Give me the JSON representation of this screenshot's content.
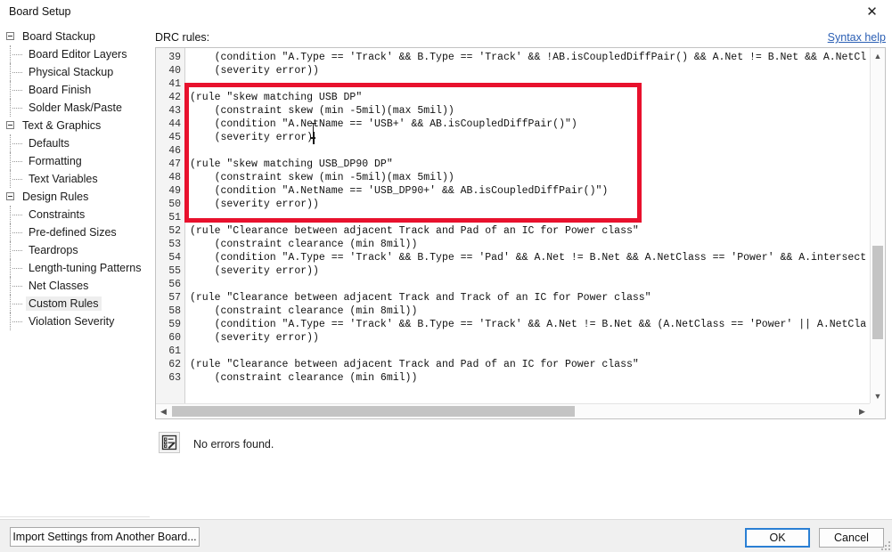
{
  "window": {
    "title": "Board Setup",
    "close_icon": "close-icon"
  },
  "sidebar": {
    "items": [
      {
        "label": "Board Stackup",
        "type": "group",
        "selected": false
      },
      {
        "label": "Board Editor Layers",
        "type": "child",
        "selected": false
      },
      {
        "label": "Physical Stackup",
        "type": "child",
        "selected": false
      },
      {
        "label": "Board Finish",
        "type": "child",
        "selected": false
      },
      {
        "label": "Solder Mask/Paste",
        "type": "child",
        "selected": false
      },
      {
        "label": "Text & Graphics",
        "type": "group",
        "selected": false
      },
      {
        "label": "Defaults",
        "type": "child",
        "selected": false
      },
      {
        "label": "Formatting",
        "type": "child",
        "selected": false
      },
      {
        "label": "Text Variables",
        "type": "child",
        "selected": false
      },
      {
        "label": "Design Rules",
        "type": "group",
        "selected": false
      },
      {
        "label": "Constraints",
        "type": "child",
        "selected": false
      },
      {
        "label": "Pre-defined Sizes",
        "type": "child",
        "selected": false
      },
      {
        "label": "Teardrops",
        "type": "child",
        "selected": false
      },
      {
        "label": "Length-tuning Patterns",
        "type": "child",
        "selected": false
      },
      {
        "label": "Net Classes",
        "type": "child",
        "selected": false
      },
      {
        "label": "Custom Rules",
        "type": "child",
        "selected": true
      },
      {
        "label": "Violation Severity",
        "type": "child",
        "selected": false
      }
    ]
  },
  "main": {
    "drc_label": "DRC rules:",
    "syntax_help": "Syntax help"
  },
  "editor": {
    "first_line_number": 39,
    "line_numbers": [
      39,
      40,
      41,
      42,
      43,
      44,
      45,
      46,
      47,
      48,
      49,
      50,
      51,
      52,
      53,
      54,
      55,
      56,
      57,
      58,
      59,
      60,
      61,
      62,
      63
    ],
    "lines": [
      "    (condition \"A.Type == 'Track' && B.Type == 'Track' && !AB.isCoupledDiffPair() && A.Net != B.Net && A.NetCl",
      "    (severity error))",
      "",
      "(rule \"skew matching USB DP\"",
      "    (constraint skew (min -5mil)(max 5mil))",
      "    (condition \"A.NetName == 'USB+' && AB.isCoupledDiffPair()\")",
      "    (severity error)",
      "",
      "(rule \"skew matching USB_DP90 DP\"",
      "    (constraint skew (min -5mil)(max 5mil))",
      "    (condition \"A.NetName == 'USB_DP90+' && AB.isCoupledDiffPair()\")",
      "    (severity error))",
      "",
      "(rule \"Clearance between adjacent Track and Pad of an IC for Power class\"",
      "    (constraint clearance (min 8mil))",
      "    (condition \"A.Type == 'Track' && B.Type == 'Pad' && A.Net != B.Net && A.NetClass == 'Power' && A.intersect",
      "    (severity error))",
      "",
      "(rule \"Clearance between adjacent Track and Track of an IC for Power class\"",
      "    (constraint clearance (min 8mil))",
      "    (condition \"A.Type == 'Track' && B.Type == 'Track' && A.Net != B.Net && (A.NetClass == 'Power' || A.NetCla",
      "    (severity error))",
      "",
      "(rule \"Clearance between adjacent Track and Pad of an IC for Power class\"",
      "    (constraint clearance (min 6mil))"
    ],
    "scrollbars": {
      "v_up_icon": "chevron-up-icon",
      "v_down_icon": "chevron-down-icon",
      "h_left_icon": "chevron-left-icon",
      "h_right_icon": "chevron-right-icon"
    },
    "annotation": {
      "shape": "rectangle",
      "color": "#e8112d",
      "covers_lines": "42-51"
    }
  },
  "results": {
    "icon": "checklist-icon",
    "message": "No errors found."
  },
  "buttons": {
    "import": "Import Settings from Another Board...",
    "ok": "OK",
    "cancel": "Cancel"
  },
  "colors": {
    "accent_link": "#2b5fb4",
    "annotation_red": "#e8112d",
    "focus_blue": "#2a7fd4",
    "selection_gray": "#eeeeee"
  }
}
